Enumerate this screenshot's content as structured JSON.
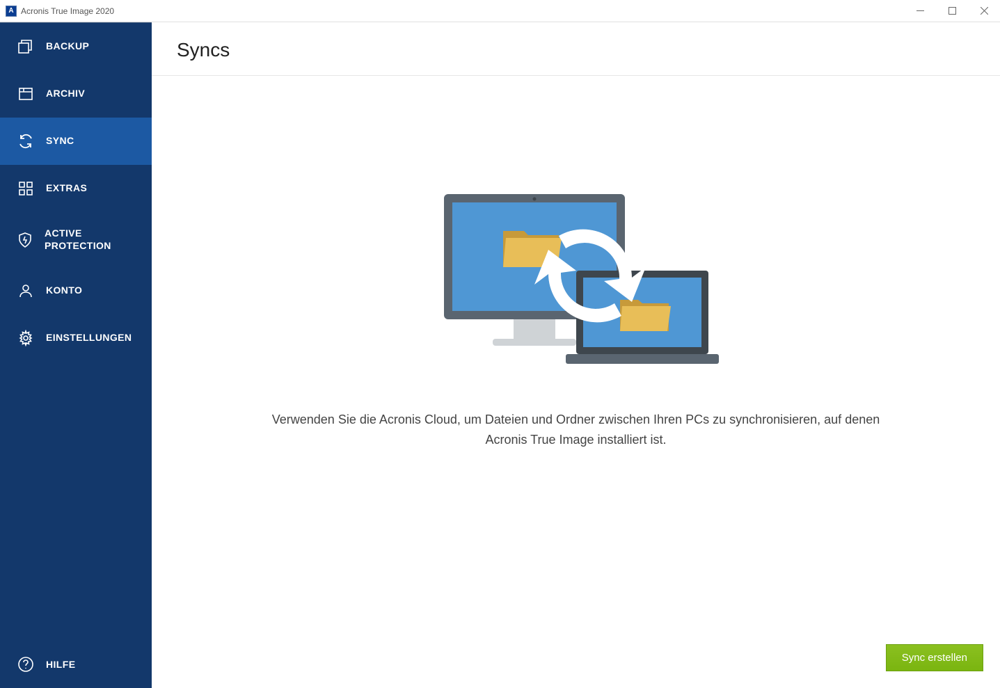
{
  "window": {
    "title": "Acronis True Image 2020",
    "app_icon_letter": "A"
  },
  "sidebar": {
    "items": [
      {
        "label": "BACKUP",
        "icon": "backup-icon",
        "active": false
      },
      {
        "label": "ARCHIV",
        "icon": "archive-icon",
        "active": false
      },
      {
        "label": "SYNC",
        "icon": "sync-icon",
        "active": true
      },
      {
        "label": "EXTRAS",
        "icon": "extras-icon",
        "active": false
      },
      {
        "label": "ACTIVE PROTECTION",
        "icon": "shield-icon",
        "active": false
      },
      {
        "label": "KONTO",
        "icon": "account-icon",
        "active": false
      },
      {
        "label": "EINSTELLUNGEN",
        "icon": "gear-icon",
        "active": false
      }
    ],
    "help": {
      "label": "HILFE",
      "icon": "help-icon"
    }
  },
  "main": {
    "heading": "Syncs",
    "description": "Verwenden Sie die Acronis Cloud, um Dateien und Ordner zwischen Ihren PCs zu synchronisieren, auf denen Acronis True Image installiert ist.",
    "primary_button": "Sync erstellen"
  },
  "colors": {
    "sidebar_bg": "#13386b",
    "sidebar_active": "#1c59a3",
    "primary_button": "#7cb518"
  }
}
